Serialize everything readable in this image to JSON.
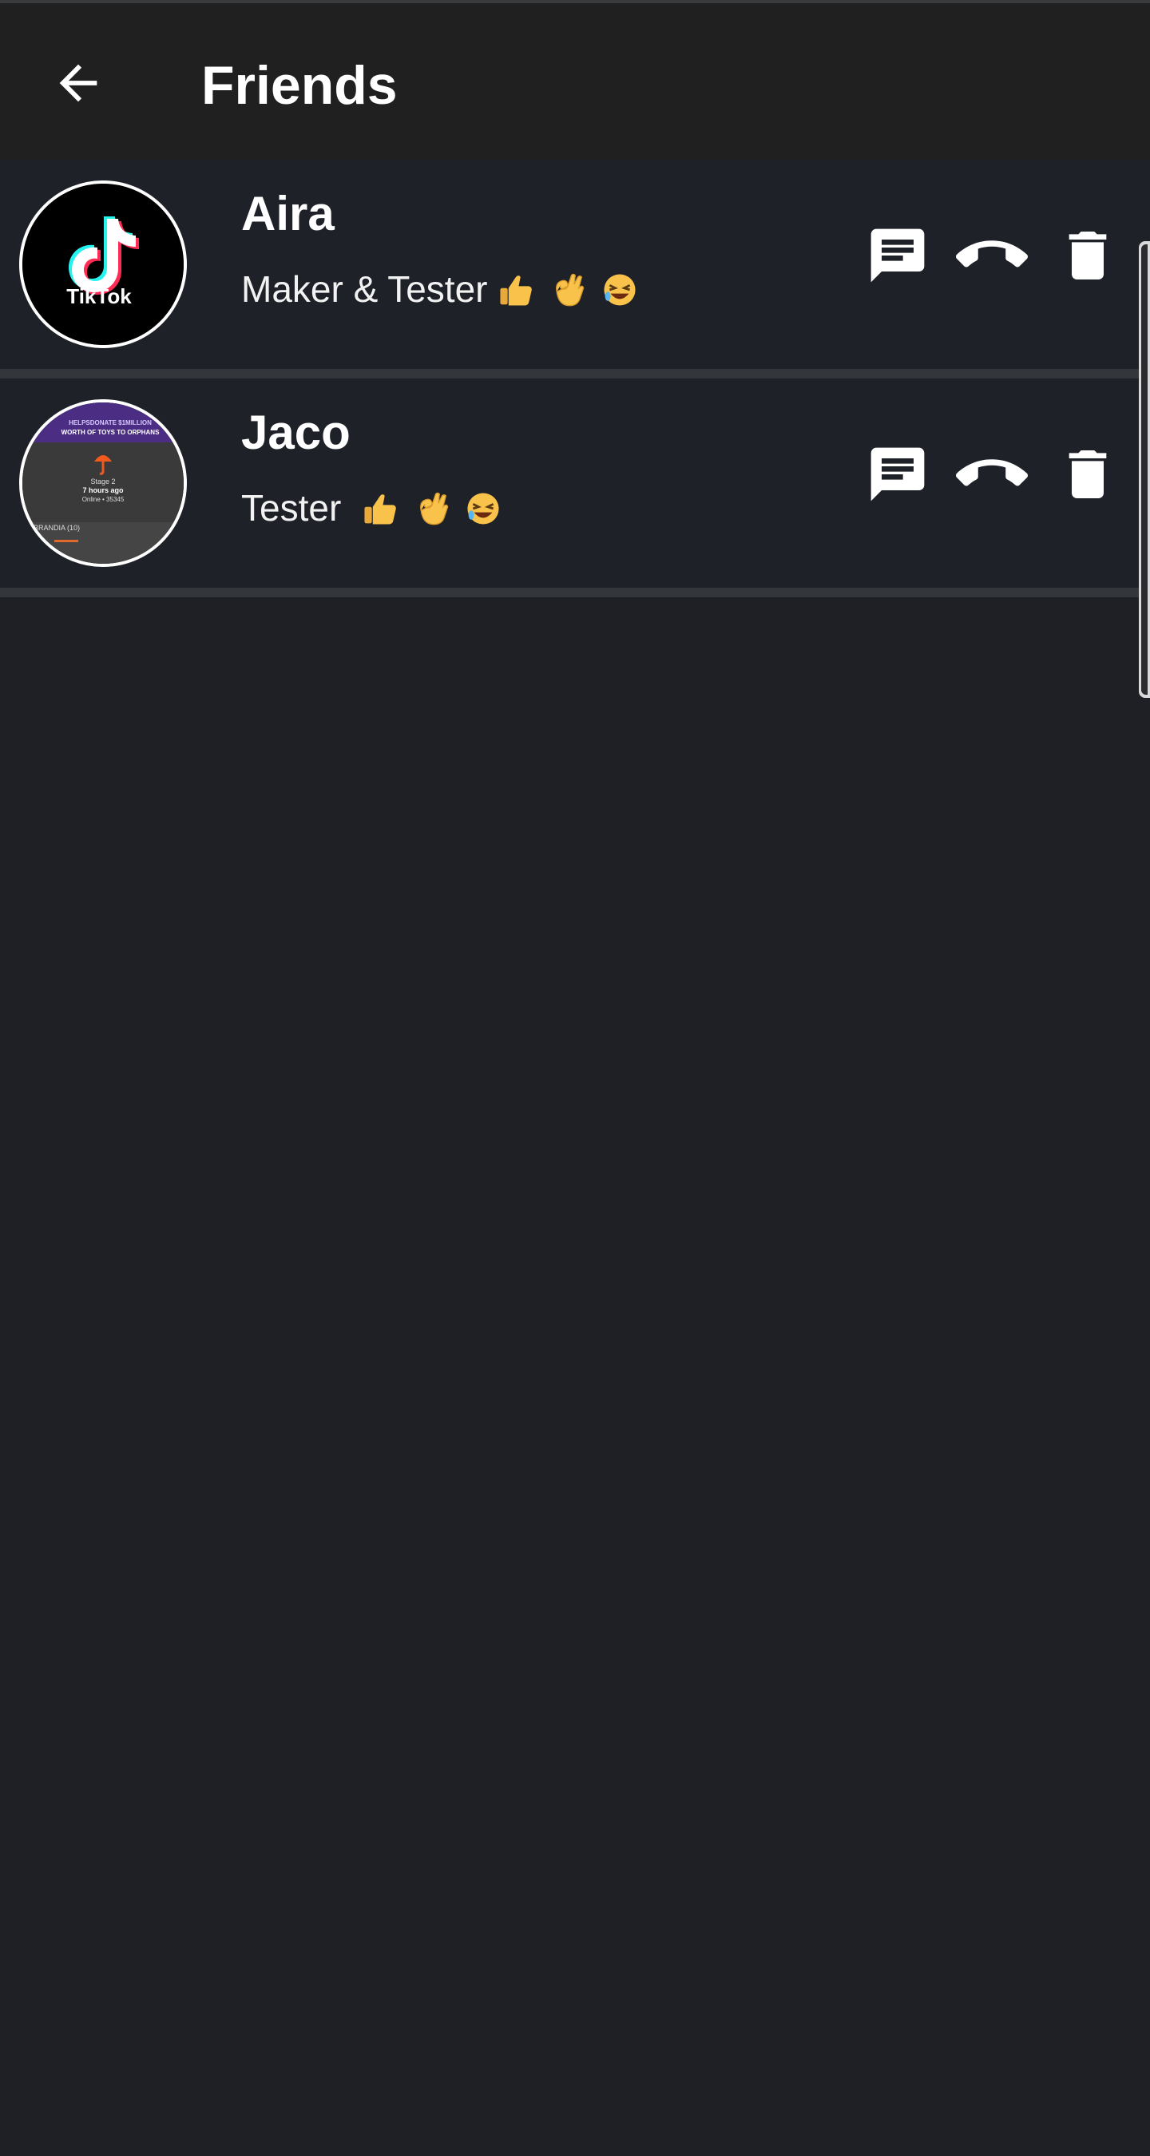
{
  "app": {
    "title": "Friends",
    "back_icon": "arrow-left-icon"
  },
  "friends": [
    {
      "name": "Aira",
      "status": "Maker & Tester",
      "status_emojis": [
        "thumbs-up",
        "ok-hand",
        "rolling-laughing"
      ],
      "avatar": {
        "type": "logo",
        "label": "TikTok"
      },
      "actions": {
        "message_icon": "message-icon",
        "call_icon": "phone-icon",
        "delete_icon": "trash-icon"
      }
    },
    {
      "name": "Jaco",
      "status": "Tester",
      "status_emojis": [
        "thumbs-up",
        "ok-hand",
        "rolling-laughing"
      ],
      "avatar": {
        "type": "screenshot",
        "lines": [
          "HELPSDONATE $1MILLION",
          "WORTH OF TOYS TO ORPHANS",
          "Stage 2",
          "7 hours ago",
          "Online • 35345",
          "BRANDIA (10)"
        ]
      },
      "actions": {
        "message_icon": "message-icon",
        "call_icon": "phone-icon",
        "delete_icon": "trash-icon"
      }
    }
  ],
  "colors": {
    "background": "#1e2025",
    "appbar": "#202020",
    "divider": "#33363b",
    "text": "#ffffff"
  }
}
